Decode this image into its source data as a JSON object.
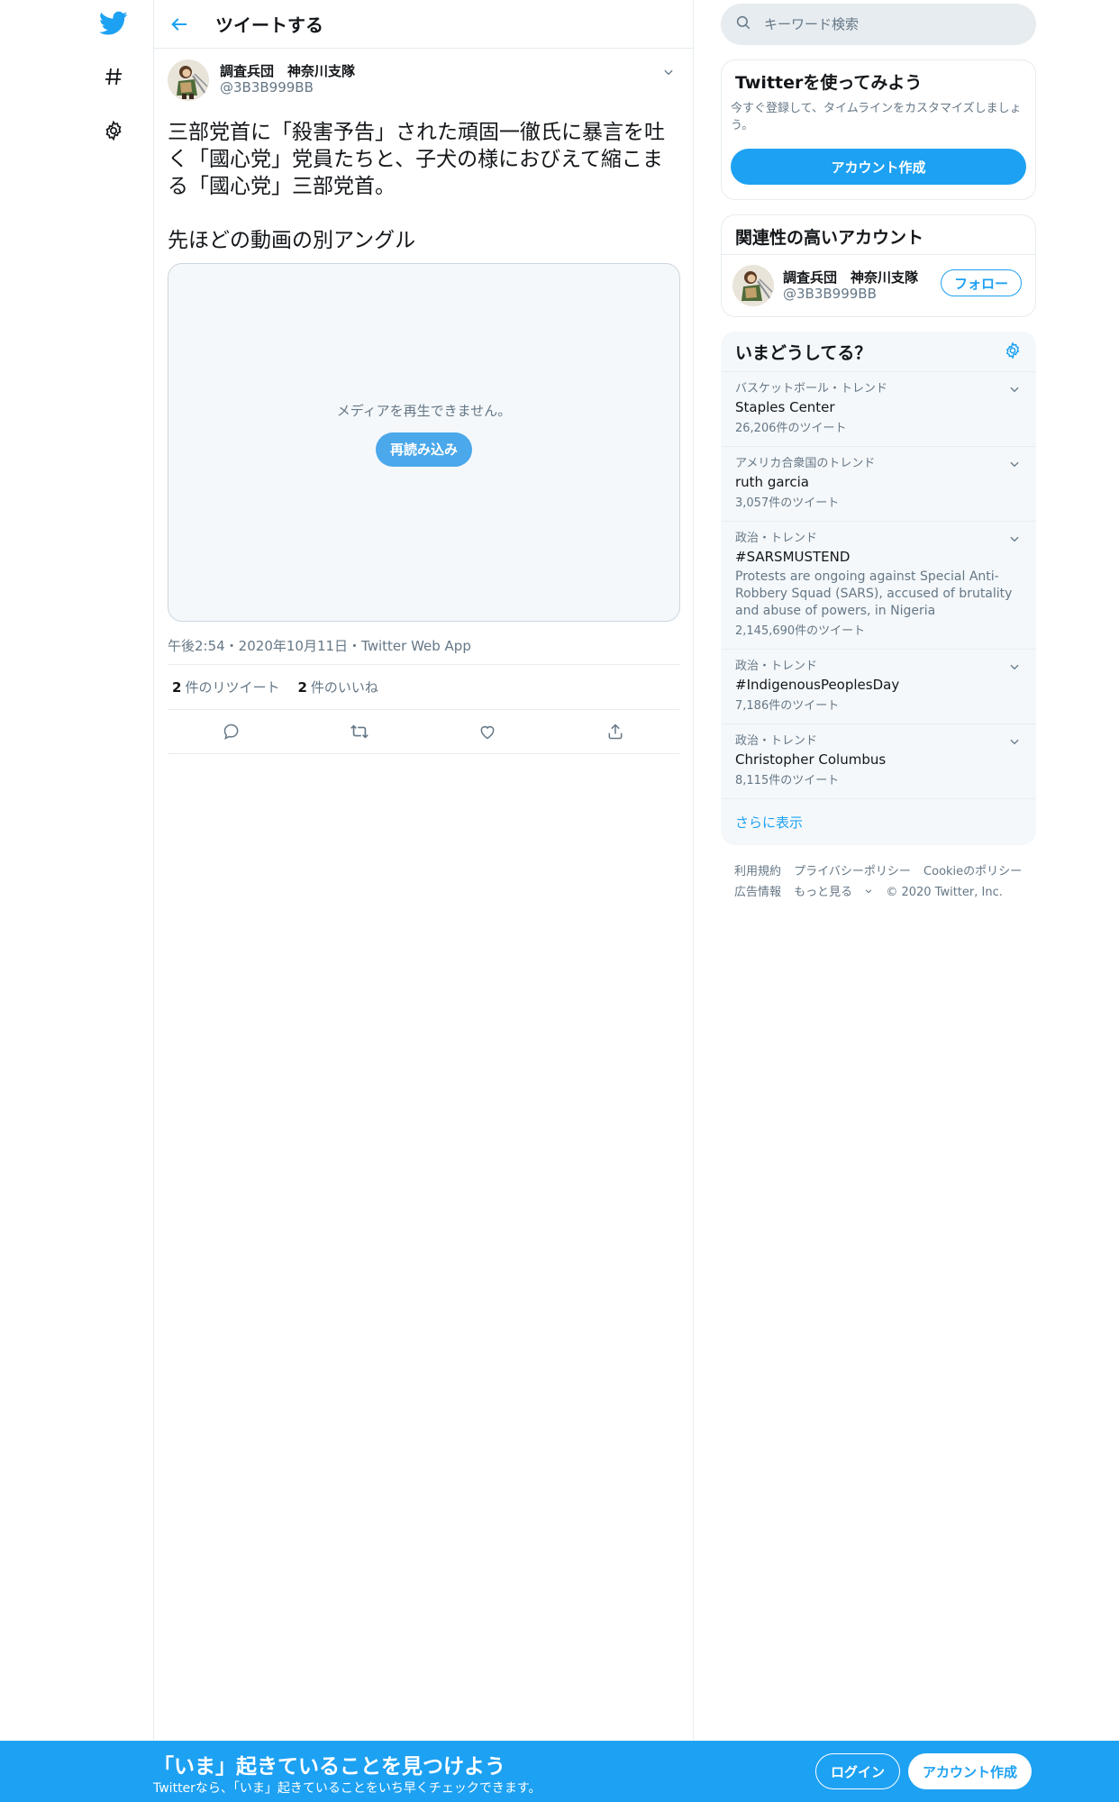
{
  "header": {
    "title": "ツイートする"
  },
  "tweet": {
    "author_name": "調査兵団　神奈川支隊",
    "author_handle": "@3B3B999BB",
    "text": "三部党首に「殺害予告」された頑固一徹氏に暴言を吐く「國心党」党員たちと、子犬の様におびえて縮こまる「國心党」三部党首。\n\n先ほどの動画の別アングル",
    "media_message": "メディアを再生できません。",
    "reload_label": "再読み込み",
    "meta": "午後2:54・2020年10月11日・Twitter Web App",
    "retweet_count": "2",
    "retweet_label": "件のリツイート",
    "like_count": "2",
    "like_label": "件のいいね"
  },
  "search": {
    "placeholder": "キーワード検索"
  },
  "signup_card": {
    "title": "Twitterを使ってみよう",
    "desc": "今すぐ登録して、タイムラインをカスタマイズしましょう。",
    "button": "アカウント作成"
  },
  "related": {
    "title": "関連性の高いアカウント",
    "name": "調査兵団　神奈川支隊",
    "handle": "@3B3B999BB",
    "follow": "フォロー"
  },
  "trends": {
    "title": "いまどうしてる？",
    "items": [
      {
        "context": "バスケットボール・トレンド",
        "name": "Staples Center",
        "desc": "",
        "count": "26,206件のツイート"
      },
      {
        "context": "アメリカ合衆国のトレンド",
        "name": "ruth garcia",
        "desc": "",
        "count": "3,057件のツイート"
      },
      {
        "context": "政治・トレンド",
        "name": "#SARSMUSTEND",
        "desc": "Protests are ongoing against Special Anti-Robbery Squad (SARS), accused of brutality and abuse of powers, in Nigeria",
        "count": "2,145,690件のツイート"
      },
      {
        "context": "政治・トレンド",
        "name": "#IndigenousPeoplesDay",
        "desc": "",
        "count": "7,186件のツイート"
      },
      {
        "context": "政治・トレンド",
        "name": "Christopher Columbus",
        "desc": "",
        "count": "8,115件のツイート"
      }
    ],
    "show_more": "さらに表示"
  },
  "footer": {
    "terms": "利用規約",
    "privacy": "プライバシーポリシー",
    "cookie": "Cookieのポリシー",
    "ads": "広告情報",
    "more": "もっと見る",
    "copyright": "© 2020 Twitter, Inc."
  },
  "bottom_bar": {
    "title": "「いま」起きていることを見つけよう",
    "subtitle": "Twitterなら、「いま」起きていることをいち早くチェックできます。",
    "login": "ログイン",
    "signup": "アカウント作成"
  },
  "colors": {
    "brand": "#1da1f2",
    "text": "#14171a",
    "secondary": "#657786",
    "border": "#e6ecf0"
  }
}
